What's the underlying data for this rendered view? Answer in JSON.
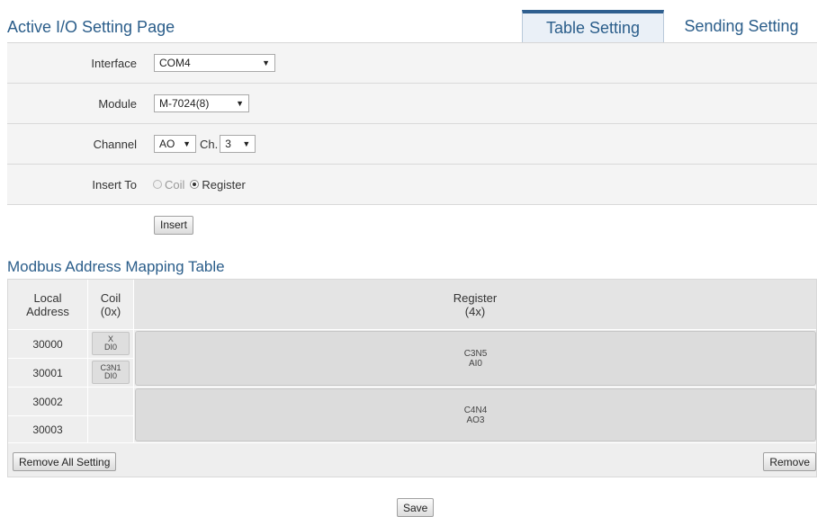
{
  "header": {
    "title": "Active I/O Setting Page",
    "tabs": [
      {
        "label": "Table Setting",
        "active": true
      },
      {
        "label": "Sending Setting",
        "active": false
      }
    ]
  },
  "form": {
    "interface": {
      "label": "Interface",
      "value": "COM4"
    },
    "module": {
      "label": "Module",
      "value": "M-7024(8)"
    },
    "channel": {
      "label": "Channel",
      "type_value": "AO",
      "ch_label": "Ch.",
      "ch_value": "3"
    },
    "insert_to": {
      "label": "Insert To",
      "options": [
        "Coil",
        "Register"
      ],
      "selected": "Register"
    },
    "insert_button": "Insert"
  },
  "mapping": {
    "title": "Modbus Address Mapping Table",
    "headers": {
      "local_address": "Local Address",
      "coil": "Coil",
      "coil_sub": "(0x)",
      "register": "Register",
      "register_sub": "(4x)"
    },
    "addresses": [
      "30000",
      "30001",
      "30002",
      "30003"
    ],
    "coils": [
      {
        "line1": "X",
        "line2": "DI0"
      },
      {
        "line1": "C3N1",
        "line2": "DI0"
      }
    ],
    "registers": [
      {
        "line1": "C3N5",
        "line2": "AI0"
      },
      {
        "line1": "C4N4",
        "line2": "AO3"
      }
    ],
    "remove_all_button": "Remove All Setting",
    "remove_button": "Remove"
  },
  "footer": {
    "save_button": "Save"
  },
  "colors": {
    "accent": "#2a5d8a",
    "tab_active_border": "#2f5f8f"
  }
}
